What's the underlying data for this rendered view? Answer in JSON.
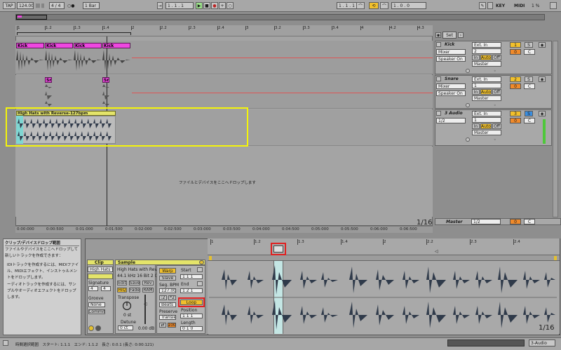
{
  "transport": {
    "tap": "TAP",
    "tempo": "124.00",
    "metronome_toggles": "||| ||",
    "time_signature": "4 / 4",
    "metronome_glyph": "○●",
    "quantize": "1 Bar",
    "arrangement_position": "1 . 1 . 1",
    "loop_start": "1 . 1 . 1",
    "loop_length": "1 . 0 . 0",
    "key_label": "KEY",
    "midi_label": "MIDI",
    "cpu": "1 %"
  },
  "ruler": {
    "bar_ticks": [
      "1",
      "1.2",
      "1.3",
      "1.4",
      "2",
      "2.2",
      "2.3",
      "2.4",
      "3",
      "3.2",
      "3.3",
      "3.4",
      "4",
      "4.2",
      "4.3",
      "4.4",
      "5"
    ],
    "time_ticks": [
      "0:00:000",
      "0:00:500",
      "0:01:000",
      "0:01:500",
      "0:02:000",
      "0:02:500",
      "0:03:000",
      "0:03:500",
      "0:04:000",
      "0:04:500",
      "0:05:000",
      "0:05:500",
      "0:06:000",
      "0:06:500"
    ],
    "set_label": "Set"
  },
  "tracks": [
    {
      "name": "Kick",
      "input": "Ext. In",
      "channel": "2",
      "routing": "Mixer",
      "monitor": "Speaker On",
      "output": "Master",
      "volume": "0",
      "pan": "C",
      "track_num": "1",
      "in_label": "In",
      "auto_label": "Auto",
      "off_label": "Off"
    },
    {
      "name": "Snare",
      "input": "Ext. In",
      "channel": "1",
      "routing": "Mixer",
      "monitor": "Speaker On",
      "output": "Master",
      "volume": "0",
      "pan": "C",
      "track_num": "2",
      "in_label": "In",
      "auto_label": "Auto",
      "off_label": "Off"
    },
    {
      "name": "3 Audio",
      "input": "Ext. In",
      "channel": "1",
      "routing": "1/2",
      "output": "Master",
      "volume": "0",
      "pan": "C",
      "track_num": "3",
      "in_label": "In",
      "auto_label": "Auto",
      "off_label": "Off"
    }
  ],
  "clips": {
    "kick_labels": [
      "Kick",
      "Kick",
      "Kick",
      "Kick"
    ],
    "snare_labels": [
      "Sna",
      "Sn"
    ],
    "hihat_label": "High Hats with Reverse-127bpm"
  },
  "drop_area": "ファイルとデバイスをここへドロップします",
  "zoom_indicator": "1/16",
  "master": {
    "name": "Master",
    "routing": "1/2",
    "volume": "0",
    "pan": "C"
  },
  "info_view": {
    "title": "クリップ/デバイスドロップ範囲",
    "line1": "ファイルやデバイスをここへドロップして新しいトラックを作成できます：",
    "bullet1": "IDIトラックを作成するには、MIDIファイル、MIDIエフェクト、インストゥルメントをドロップします。",
    "bullet2": "ーディオトラックを作成するには、サンプルやオーディオエフェクトをドロップします。"
  },
  "clip_view": {
    "clip_title": "Clip",
    "clip_name": "High Hats wi",
    "signature_label": "Signature",
    "sig_num": "4",
    "sig_den": "4",
    "groove_label": "Groove",
    "groove_value": "None",
    "commit": "Commit",
    "sample_title": "Sample",
    "sample_name": "High Hats with Rever",
    "sample_info": "44.1 kHz 16 Bit 2 Ch",
    "edit": "Edit",
    "save": "Save",
    "rev": "Rev",
    "hiq": "HiQ",
    "fade": "Fade",
    "ram": "RAM",
    "transpose_label": "Transpose",
    "transpose_value": "0 st",
    "detune_label": "Detune",
    "detune_value": "0 ct",
    "gain_value": "0.00 dB",
    "warp": "Warp",
    "slave": "Slave",
    "seg_bpm_label": "Seg. BPM",
    "seg_bpm": "127.00",
    "half": ":2",
    "double": "*2",
    "warp_mode": "Beats",
    "preserve_label": "Preserve",
    "transient": "Transien",
    "env_value": "100",
    "start_label": "Start",
    "start_value": "1  1  1",
    "end_label": "End",
    "end_value": "1  2  1",
    "loop": "Loop",
    "position_label": "Position",
    "position_value": "1  1  1",
    "length_label": "Length",
    "length_value": "0  1  0"
  },
  "sample_editor": {
    "ticks": [
      "1",
      "1.2",
      "1.3",
      "1.4",
      "2",
      "2.2",
      "2.3",
      "2.4"
    ],
    "zoom": "1/16"
  },
  "status_bar": {
    "text": "時間選択範囲　スタート: 1.1.1　エンド: 1.1.2　長さ: 0.0.1 (長さ: 0:00:121)",
    "track_label": "3-Audio"
  },
  "annotations": {
    "highlight_color": "#f4f40a",
    "marker_color": "#e02020"
  }
}
